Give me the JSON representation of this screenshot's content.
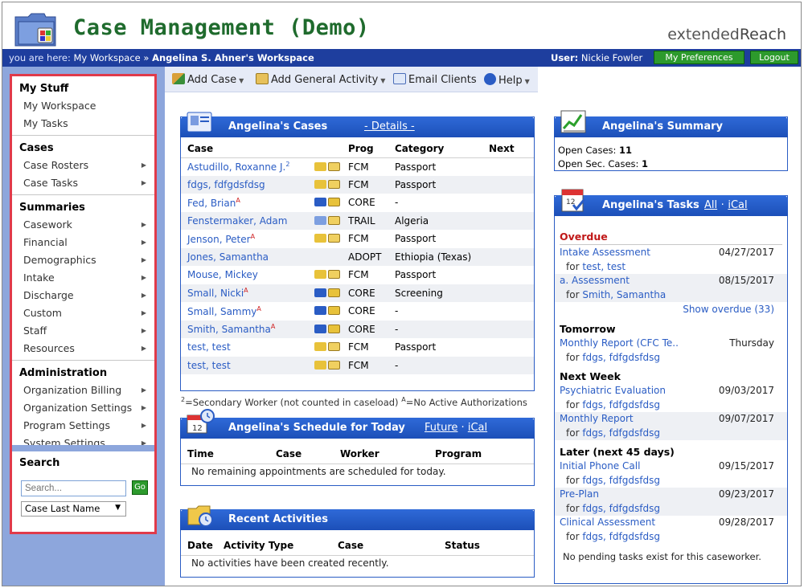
{
  "header": {
    "app_title": "Case Management (Demo)",
    "brand_prefix": "extended",
    "brand_suffix": "Reach"
  },
  "bar": {
    "you_are_here": "you are here:",
    "crumb_1": "My Workspace",
    "crumb_sep": "»",
    "crumb_2": "Angelina S. Ahner's Workspace",
    "user_label": "User:",
    "user_name": "Nickie Fowler",
    "prefs": "My Preferences",
    "logout": "Logout"
  },
  "sidebar": {
    "sections": [
      {
        "title": "My Stuff",
        "items": [
          {
            "label": "My Workspace",
            "arrow": false
          },
          {
            "label": "My Tasks",
            "arrow": false
          }
        ]
      },
      {
        "title": "Cases",
        "items": [
          {
            "label": "Case Rosters",
            "arrow": true
          },
          {
            "label": "Case Tasks",
            "arrow": true
          }
        ]
      },
      {
        "title": "Summaries",
        "items": [
          {
            "label": "Casework",
            "arrow": true
          },
          {
            "label": "Financial",
            "arrow": true
          },
          {
            "label": "Demographics",
            "arrow": true
          },
          {
            "label": "Intake",
            "arrow": true
          },
          {
            "label": "Discharge",
            "arrow": true
          },
          {
            "label": "Custom",
            "arrow": true
          },
          {
            "label": "Staff",
            "arrow": true
          },
          {
            "label": "Resources",
            "arrow": true
          }
        ]
      },
      {
        "title": "Administration",
        "items": [
          {
            "label": "Organization Billing",
            "arrow": true
          },
          {
            "label": "Organization Settings",
            "arrow": true
          },
          {
            "label": "Program Settings",
            "arrow": true
          },
          {
            "label": "System Settings",
            "arrow": true
          }
        ]
      }
    ],
    "search": {
      "title": "Search",
      "placeholder": "Search...",
      "go": "Go",
      "select_value": "Case Last Name"
    }
  },
  "toolbar": {
    "add_case": "Add Case",
    "add_activity": "Add General Activity",
    "email": "Email Clients",
    "help": "Help"
  },
  "cases_panel": {
    "title": "Angelina's Cases",
    "details": "- Details -",
    "headers": [
      "Case",
      "Prog",
      "Category",
      "Next"
    ],
    "rows": [
      {
        "name": "Astudillo, Roxanne J.",
        "mark": "2",
        "mark_type": "sec",
        "icon": "yellow",
        "prog": "FCM",
        "category": "Passport"
      },
      {
        "name": "fdgs, fdfgdsfdsg",
        "mark": "",
        "mark_type": "",
        "icon": "yellow",
        "prog": "FCM",
        "category": "Passport"
      },
      {
        "name": "Fed, Brian",
        "mark": "A",
        "mark_type": "auth",
        "icon": "blue",
        "prog": "CORE",
        "category": "-"
      },
      {
        "name": "Fenstermaker, Adam",
        "mark": "",
        "mark_type": "",
        "icon": "multi",
        "prog": "TRAIL",
        "category": "Algeria"
      },
      {
        "name": "Jenson, Peter",
        "mark": "A",
        "mark_type": "auth",
        "icon": "yellow",
        "prog": "FCM",
        "category": "Passport"
      },
      {
        "name": "Jones, Samantha",
        "mark": "",
        "mark_type": "",
        "icon": "none",
        "prog": "ADOPT",
        "category": "Ethiopia (Texas)"
      },
      {
        "name": "Mouse, Mickey",
        "mark": "",
        "mark_type": "",
        "icon": "yellow",
        "prog": "FCM",
        "category": "Passport"
      },
      {
        "name": "Small, Nicki",
        "mark": "A",
        "mark_type": "auth",
        "icon": "blue",
        "prog": "CORE",
        "category": "Screening"
      },
      {
        "name": "Small, Sammy",
        "mark": "A",
        "mark_type": "auth",
        "icon": "blue",
        "prog": "CORE",
        "category": "-"
      },
      {
        "name": "Smith, Samantha",
        "mark": "A",
        "mark_type": "auth",
        "icon": "blue",
        "prog": "CORE",
        "category": "-"
      },
      {
        "name": "test, test",
        "mark": "",
        "mark_type": "",
        "icon": "yellow",
        "prog": "FCM",
        "category": "Passport"
      },
      {
        "name": "test, test",
        "mark": "",
        "mark_type": "",
        "icon": "yellow",
        "prog": "FCM",
        "category": "-"
      }
    ],
    "note_sec_mark": "2",
    "note_sec": "=Secondary Worker (not counted in caseload) ",
    "note_auth_mark": "A",
    "note_auth": "=No Active Authorizations"
  },
  "schedule_panel": {
    "title": "Angelina's Schedule for Today",
    "future": "Future",
    "sep": "·",
    "ical": "iCal",
    "headers": [
      "Time",
      "Case",
      "Worker",
      "Program"
    ],
    "empty": "No remaining appointments are scheduled for today."
  },
  "activities_panel": {
    "title": "Recent Activities",
    "headers": [
      "Date",
      "Activity Type",
      "Case",
      "Status"
    ],
    "empty": "No activities have been created recently."
  },
  "summary_panel": {
    "title": "Angelina's Summary",
    "open_label": "Open Cases:",
    "open_value": "11",
    "sec_label": "Open Sec. Cases:",
    "sec_value": "1"
  },
  "tasks_panel": {
    "title": "Angelina's Tasks",
    "all": "All",
    "sep": "·",
    "ical": "iCal",
    "overdue": "Overdue",
    "show_overdue": "Show overdue (33)",
    "overdue_tasks": [
      {
        "name": "Intake Assessment",
        "date": "04/27/2017",
        "for": "for",
        "who": "test, test"
      },
      {
        "name": "a. Assessment",
        "date": "08/15/2017",
        "for": "for",
        "who": "Smith, Samantha"
      }
    ],
    "tomorrow": "Tomorrow",
    "tomorrow_tasks": [
      {
        "name": "Monthly Report (CFC Te..",
        "date": "Thursday",
        "for": "for",
        "who": "fdgs, fdfgdsfdsg"
      }
    ],
    "next_week": "Next Week",
    "next_week_tasks": [
      {
        "name": "Psychiatric Evaluation",
        "date": "09/03/2017",
        "for": "for",
        "who": "fdgs, fdfgdsfdsg"
      },
      {
        "name": "Monthly Report",
        "date": "09/07/2017",
        "for": "for",
        "who": "fdgs, fdfgdsfdsg"
      }
    ],
    "later": "Later (next 45 days)",
    "later_tasks": [
      {
        "name": "Initial Phone Call",
        "date": "09/15/2017",
        "for": "for",
        "who": "fdgs, fdfgdsfdsg"
      },
      {
        "name": "Pre-Plan",
        "date": "09/23/2017",
        "for": "for",
        "who": "fdgs, fdfgdsfdsg"
      },
      {
        "name": "Clinical Assessment",
        "date": "09/28/2017",
        "for": "for",
        "who": "fdgs, fdfgdsfdsg"
      }
    ],
    "pending": "No pending tasks exist for this caseworker."
  }
}
